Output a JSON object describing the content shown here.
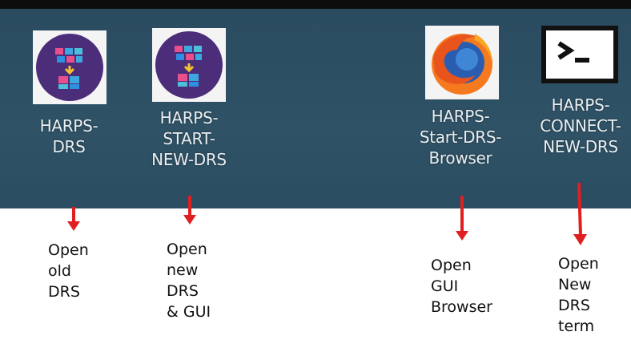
{
  "desktop_icons": [
    {
      "label": "HARPS-\nDRS",
      "icon": "harps-drs-icon"
    },
    {
      "label": "HARPS-\nSTART-\nNEW-DRS",
      "icon": "harps-drs-icon"
    },
    {
      "label": "HARPS-\nStart-DRS-\nBrowser",
      "icon": "firefox-icon"
    },
    {
      "label": "HARPS-\nCONNECT-\nNEW-DRS",
      "icon": "terminal-icon"
    }
  ],
  "annotations": [
    {
      "text": "Open\nold\nDRS"
    },
    {
      "text": "Open\nnew\nDRS\n& GUI"
    },
    {
      "text": "Open\nGUI\nBrowser"
    },
    {
      "text": "Open\nNew\nDRS\nterm"
    }
  ],
  "colors": {
    "desktop_background": "#2e5064",
    "arrow": "#e02020",
    "drs_icon_purple": "#4b2d7a"
  }
}
